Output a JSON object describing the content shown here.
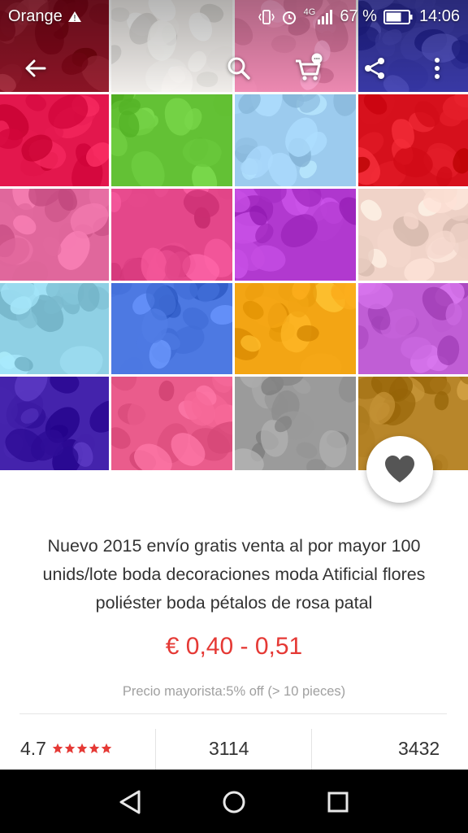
{
  "status_bar": {
    "carrier": "Orange",
    "network": "4G",
    "battery": "67 %",
    "time": "14:06"
  },
  "toolbar": {
    "back_icon": "arrow-left-icon",
    "search_icon": "search-icon",
    "cart_icon": "cart-icon",
    "share_icon": "share-icon",
    "more_icon": "more-vertical-icon"
  },
  "gallery": {
    "tile_colors": [
      [
        "#8c1426",
        "#f4f1ee",
        "#f08bb4",
        "#3a3aa8"
      ],
      [
        "#e3174d",
        "#63c135",
        "#9ccbee",
        "#d6101c"
      ],
      [
        "#e0679c",
        "#e4478a",
        "#b139cf",
        "#f0d3c8"
      ],
      [
        "#8fd0e4",
        "#4d79e2",
        "#f3a514",
        "#c05ed5"
      ],
      [
        "#4423ac",
        "#ea5c8c",
        "#9b9b9b",
        "#b8862a"
      ]
    ]
  },
  "favorite": {
    "icon": "heart-icon"
  },
  "product": {
    "title": "Nuevo 2015 envío gratis venta al por mayor 100 unids/lote boda decoraciones moda Atificial flores poliéster boda pétalos de rosa patal",
    "price": "€ 0,40 - 0,51",
    "price_color": "#e53935",
    "wholesale": "Precio mayorista:5% off (> 10 pieces)"
  },
  "stats": {
    "rating": "4.7",
    "rating_stars": 5,
    "orders": "3114",
    "wishlist": "3432"
  },
  "nav_bar": {
    "back_icon": "triangle-back-icon",
    "home_icon": "circle-home-icon",
    "recents_icon": "square-recents-icon"
  }
}
